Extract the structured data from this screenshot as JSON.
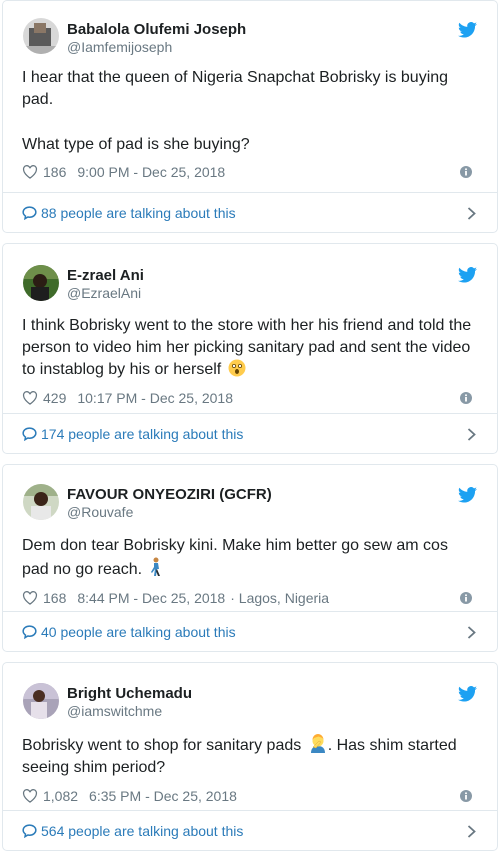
{
  "colors": {
    "link": "#2b7bb9",
    "muted": "#697882",
    "text": "#1c2022",
    "border": "#e1e8ed",
    "twitter_blue": "#1da1f2"
  },
  "icons": [
    "twitter-bird-icon",
    "heart-icon",
    "info-icon",
    "speech-bubble-icon",
    "chevron-right-icon"
  ],
  "tweets": [
    {
      "display_name": "Babalola Olufemi Joseph",
      "handle": "@Iamfemijoseph",
      "text_lines": [
        "I hear that the queen of Nigeria Snapchat Bobrisky is buying pad.",
        "What type of pad is she buying?"
      ],
      "likes": "186",
      "timestamp": "9:00 PM - Dec 25, 2018",
      "location": "",
      "talking": "88 people are talking about this"
    },
    {
      "display_name": "E-zrael Ani",
      "handle": "@EzraelAni",
      "text": "I think Bobrisky went to the store with her his friend and told the person to video him her picking sanitary pad and sent the video to instablog by his or herself",
      "emoji": "astonished-face-emoji",
      "likes": "429",
      "timestamp": "10:17 PM - Dec 25, 2018",
      "location": "",
      "talking": "174 people are talking about this"
    },
    {
      "display_name": "FAVOUR ONYEOZIRI (GCFR)",
      "handle": "@Rouvafe",
      "text": "Dem don tear Bobrisky kini. Make him better go sew am cos pad no go reach.",
      "emoji": "person-walking-emoji",
      "likes": "168",
      "timestamp": "8:44 PM - Dec 25, 2018",
      "location": "· Lagos, Nigeria",
      "talking": "40 people are talking about this"
    },
    {
      "display_name": "Bright Uchemadu",
      "handle": "@iamswitchme",
      "text_pre": "Bobrisky went to shop for sanitary pads",
      "emoji": "person-facepalming-emoji",
      "text_post": ". Has shim started seeing shim period?",
      "likes": "1,082",
      "timestamp": "6:35 PM - Dec 25, 2018",
      "location": "",
      "talking": "564 people are talking about this"
    }
  ]
}
